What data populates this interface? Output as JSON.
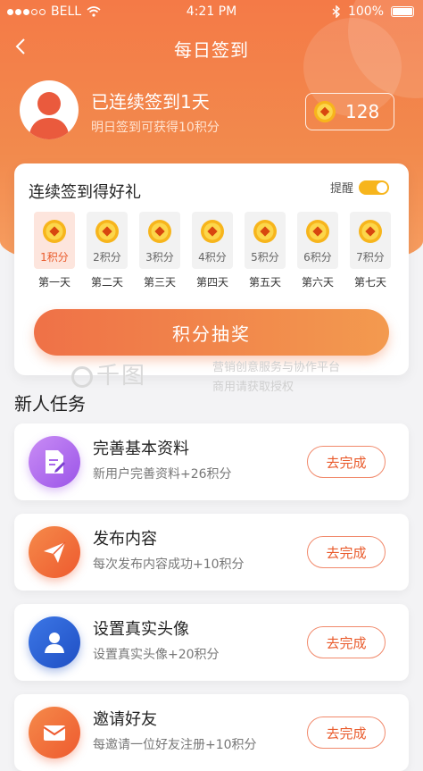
{
  "status_bar": {
    "carrier": "BELL",
    "time": "4:21 PM",
    "battery": "100%"
  },
  "nav": {
    "title": "每日签到"
  },
  "profile": {
    "streak_text": "已连续签到1天",
    "tomorrow_text": "明日签到可获得10积分",
    "points": "128"
  },
  "checkin_card": {
    "title": "连续签到得好礼",
    "remind_label": "提醒",
    "remind_on": true,
    "days": [
      {
        "points": "1积分",
        "label": "第一天",
        "active": true
      },
      {
        "points": "2积分",
        "label": "第二天",
        "active": false
      },
      {
        "points": "3积分",
        "label": "第三天",
        "active": false
      },
      {
        "points": "4积分",
        "label": "第四天",
        "active": false
      },
      {
        "points": "5积分",
        "label": "第五天",
        "active": false
      },
      {
        "points": "6积分",
        "label": "第六天",
        "active": false
      },
      {
        "points": "7积分",
        "label": "第七天",
        "active": false
      }
    ],
    "lottery_label": "积分抽奖"
  },
  "watermark": {
    "logo": "千图",
    "line1": "营销创意服务与协作平台",
    "line2": "商用请获取授权"
  },
  "tasks": {
    "title": "新人任务",
    "items": [
      {
        "name": "完善基本资料",
        "desc": "新用户完善资料+26积分",
        "button": "去完成",
        "icon": "document-edit-icon"
      },
      {
        "name": "发布内容",
        "desc": "每次发布内容成功+10积分",
        "button": "去完成",
        "icon": "paper-plane-icon"
      },
      {
        "name": "设置真实头像",
        "desc": "设置真实头像+20积分",
        "button": "去完成",
        "icon": "user-icon"
      },
      {
        "name": "邀请好友",
        "desc": "每邀请一位好友注册+10积分",
        "button": "去完成",
        "icon": "envelope-icon"
      }
    ]
  },
  "colors": {
    "accent": "#f47a47",
    "coin": "#f7b51c",
    "button_text": "#e95a2b"
  }
}
